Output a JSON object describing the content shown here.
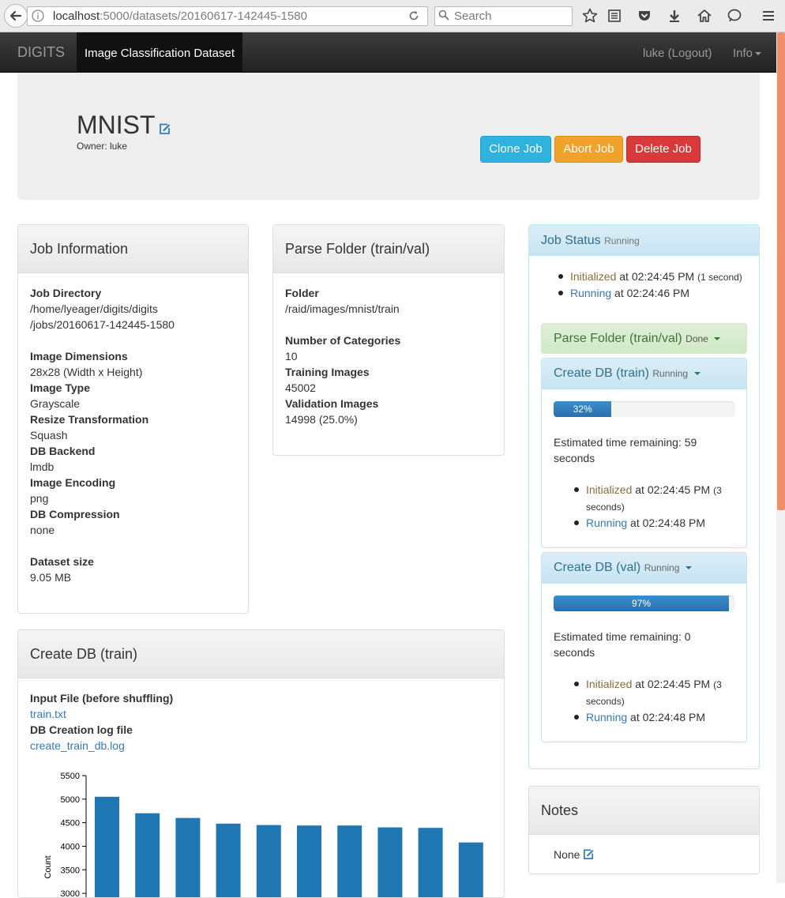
{
  "browser": {
    "url_host": "localhost",
    "url_path": ":5000/datasets/20160617-142445-1580",
    "search_placeholder": "Search"
  },
  "navbar": {
    "brand": "DIGITS",
    "active_tab": "Image Classification Dataset",
    "user": "luke (Logout)",
    "info": "Info"
  },
  "header": {
    "job_name": "MNIST",
    "owner": "Owner: luke",
    "clone_label": "Clone Job",
    "abort_label": "Abort Job",
    "delete_label": "Delete Job"
  },
  "job_info": {
    "title": "Job Information",
    "job_directory_label": "Job Directory",
    "job_directory_line1": "/home/lyeager/digits/digits",
    "job_directory_line2": "/jobs/20160617-142445-1580",
    "image_dimensions_label": "Image Dimensions",
    "image_dimensions": "28x28 (Width x Height)",
    "image_type_label": "Image Type",
    "image_type": "Grayscale",
    "resize_label": "Resize Transformation",
    "resize": "Squash",
    "db_backend_label": "DB Backend",
    "db_backend": "lmdb",
    "image_encoding_label": "Image Encoding",
    "image_encoding": "png",
    "db_compression_label": "DB Compression",
    "db_compression": "none",
    "dataset_size_label": "Dataset size",
    "dataset_size": "9.05 MB"
  },
  "parse_folder": {
    "title": "Parse Folder (train/val)",
    "folder_label": "Folder",
    "folder": "/raid/images/mnist/train",
    "categories_label": "Number of Categories",
    "categories": "10",
    "training_label": "Training Images",
    "training": "45002",
    "validation_label": "Validation Images",
    "validation": "14998 (25.0%)"
  },
  "create_db_train": {
    "title": "Create DB (train)",
    "input_file_label": "Input File (before shuffling)",
    "input_file": "train.txt",
    "log_label": "DB Creation log file",
    "log_file": "create_train_db.log"
  },
  "job_status": {
    "title": "Job Status",
    "state": "Running",
    "events": [
      {
        "state": "Initialized",
        "time": "at 02:24:45 PM",
        "duration": "(1 second)"
      },
      {
        "state": "Running",
        "time": "at 02:24:46 PM",
        "duration": ""
      }
    ],
    "parse_task": {
      "title": "Parse Folder (train/val)",
      "state": "Done"
    },
    "train_task": {
      "title": "Create DB (train)",
      "state": "Running",
      "progress": 0.32,
      "progress_label": "32%",
      "eta_line1": "Estimated time remaining: 59",
      "eta_line2": "seconds",
      "events": [
        {
          "state": "Initialized",
          "time": "at 02:24:45 PM",
          "duration_1": "(3",
          "duration_2": "seconds)"
        },
        {
          "state": "Running",
          "time": "at 02:24:48 PM"
        }
      ]
    },
    "val_task": {
      "title": "Create DB (val)",
      "state": "Running",
      "progress": 0.97,
      "progress_label": "97%",
      "eta_line1": "Estimated time remaining: 0",
      "eta_line2": "seconds",
      "events": [
        {
          "state": "Initialized",
          "time": "at 02:24:45 PM",
          "duration_1": "(3",
          "duration_2": "seconds)"
        },
        {
          "state": "Running",
          "time": "at 02:24:48 PM"
        }
      ]
    }
  },
  "notes": {
    "title": "Notes",
    "value": "None"
  },
  "colors": {
    "bar": "#1f77b4",
    "initialized": "#8a6d3b",
    "running": "#337ab7"
  },
  "chart_data": {
    "type": "bar",
    "ylabel": "Count",
    "yticks": [
      3000,
      3500,
      4000,
      4500,
      5000,
      5500
    ],
    "ylim": [
      2800,
      5500
    ],
    "categories": [
      "",
      "",
      "",
      "",
      "",
      "",
      "",
      "",
      "",
      ""
    ],
    "values": [
      5050,
      4700,
      4600,
      4480,
      4450,
      4440,
      4440,
      4400,
      4390,
      4080
    ]
  }
}
